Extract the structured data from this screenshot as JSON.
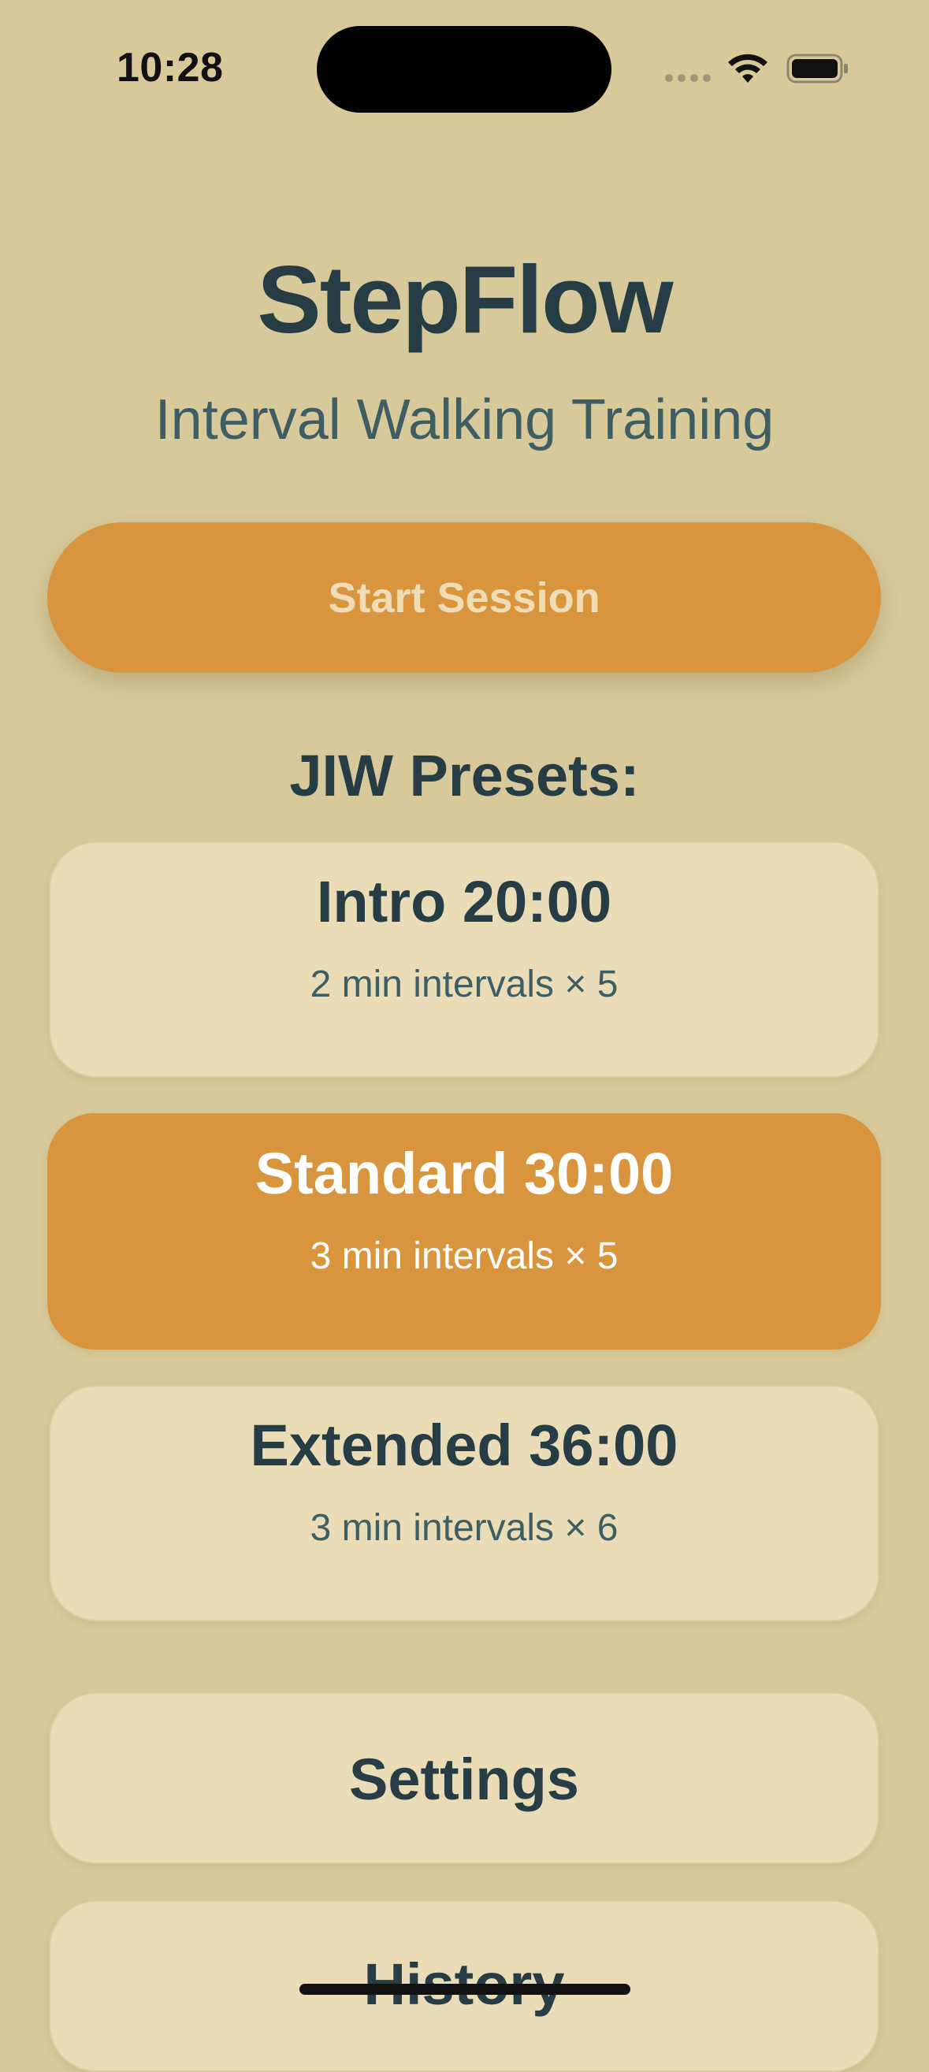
{
  "status_bar": {
    "time": "10:28"
  },
  "header": {
    "title": "StepFlow",
    "subtitle": "Interval Walking Training"
  },
  "actions": {
    "start_label": "Start Session"
  },
  "presets": {
    "heading": "JIW Presets:",
    "items": [
      {
        "title": "Intro 20:00",
        "subtitle": "2 min intervals × 5",
        "selected": false
      },
      {
        "title": "Standard 30:00",
        "subtitle": "3 min intervals × 5",
        "selected": true
      },
      {
        "title": "Extended 36:00",
        "subtitle": "3 min intervals × 6",
        "selected": false
      }
    ]
  },
  "nav": {
    "settings_label": "Settings",
    "history_label": "History"
  },
  "colors": {
    "background": "#D7C99A",
    "accent": "#D9953D",
    "card": "#EADCB7",
    "text_primary": "#263D46",
    "text_secondary": "#3F5E64"
  }
}
